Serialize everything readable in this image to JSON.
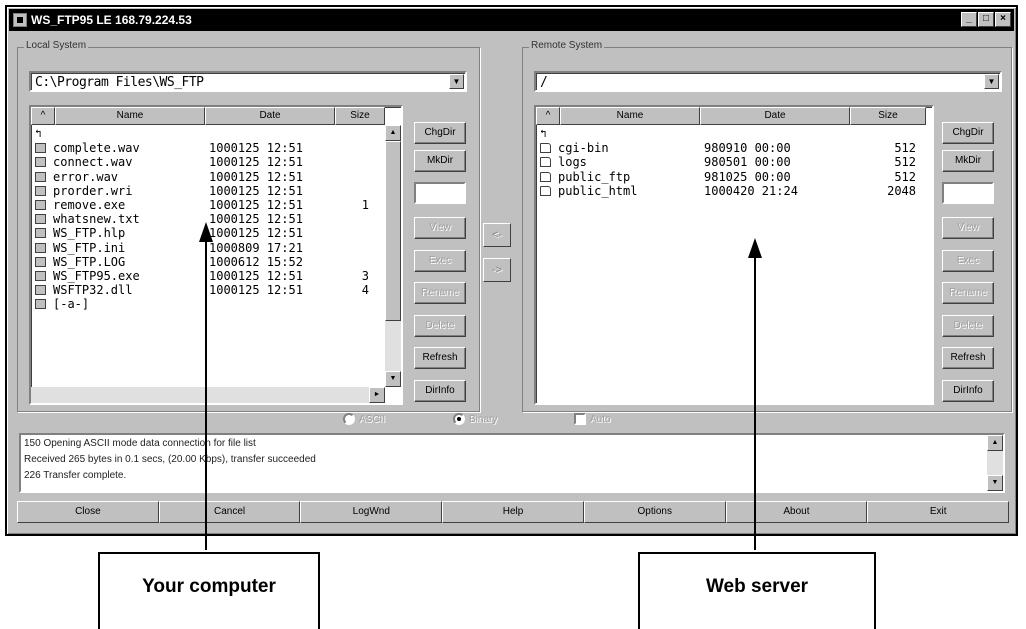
{
  "window": {
    "title": "WS_FTP95 LE 168.79.224.53"
  },
  "local": {
    "group_label": "Local System",
    "path": "C:\\Program Files\\WS_FTP",
    "columns": [
      "^",
      "Name",
      "Date",
      "Size"
    ],
    "files": [
      {
        "name": "..",
        "date": "",
        "size": "",
        "icon": "up-dir-icon"
      },
      {
        "name": "complete.wav",
        "date": "1000125 12:51",
        "size": "",
        "icon": "file-icon"
      },
      {
        "name": "connect.wav",
        "date": "1000125 12:51",
        "size": "",
        "icon": "file-icon"
      },
      {
        "name": "error.wav",
        "date": "1000125 12:51",
        "size": "",
        "icon": "file-icon"
      },
      {
        "name": "prorder.wri",
        "date": "1000125 12:51",
        "size": "",
        "icon": "file-icon"
      },
      {
        "name": "remove.exe",
        "date": "1000125 12:51",
        "size": "1",
        "icon": "file-icon"
      },
      {
        "name": "whatsnew.txt",
        "date": "1000125 12:51",
        "size": "",
        "icon": "file-icon"
      },
      {
        "name": "WS_FTP.hlp",
        "date": "1000125 12:51",
        "size": "",
        "icon": "file-icon"
      },
      {
        "name": "WS_FTP.ini",
        "date": "1000809 17:21",
        "size": "",
        "icon": "file-icon"
      },
      {
        "name": "WS_FTP.LOG",
        "date": "1000612 15:52",
        "size": "",
        "icon": "file-icon"
      },
      {
        "name": "WS_FTP95.exe",
        "date": "1000125 12:51",
        "size": "3",
        "icon": "file-icon"
      },
      {
        "name": "WSFTP32.dll",
        "date": "1000125 12:51",
        "size": "4",
        "icon": "file-icon"
      },
      {
        "name": "[-a-]",
        "date": "",
        "size": "",
        "icon": "drive-icon"
      }
    ],
    "buttons": [
      "ChgDir",
      "MkDir",
      "",
      "View",
      "Exec",
      "Rename",
      "Delete",
      "Refresh",
      "DirInfo"
    ]
  },
  "remote": {
    "group_label": "Remote System",
    "path": "/",
    "columns": [
      "^",
      "Name",
      "Date",
      "Size"
    ],
    "files": [
      {
        "name": "..",
        "date": "",
        "size": "",
        "icon": "up-dir-icon"
      },
      {
        "name": "cgi-bin",
        "date": "980910 00:00",
        "size": "512",
        "icon": "folder-icon"
      },
      {
        "name": "logs",
        "date": "980501 00:00",
        "size": "512",
        "icon": "folder-icon"
      },
      {
        "name": "public_ftp",
        "date": "981025 00:00",
        "size": "512",
        "icon": "folder-icon"
      },
      {
        "name": "public_html",
        "date": "1000420 21:24",
        "size": "2048",
        "icon": "folder-icon"
      }
    ],
    "buttons": [
      "ChgDir",
      "MkDir",
      "",
      "View",
      "Exec",
      "Rename",
      "Delete",
      "Refresh",
      "DirInfo"
    ]
  },
  "transfer": {
    "left_arrow": "<-",
    "right_arrow": "->"
  },
  "mode": {
    "ascii": "ASCII",
    "binary": "Binary",
    "auto": "Auto",
    "selected": "binary"
  },
  "log_lines": [
    "150 Opening ASCII mode data connection for file list",
    "Received 265 bytes in 0.1 secs, (20.00 Kbps), transfer succeeded",
    "226 Transfer complete."
  ],
  "bottom_buttons": [
    "Close",
    "Cancel",
    "LogWnd",
    "Help",
    "Options",
    "About",
    "Exit"
  ],
  "callouts": {
    "left": "Your computer",
    "right": "Web server"
  }
}
